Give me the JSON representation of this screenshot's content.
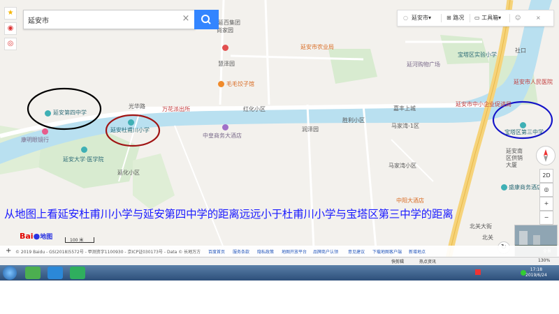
{
  "search": {
    "value": "延安市",
    "clear_icon": "×"
  },
  "toolbar": {
    "city": "延安市",
    "city_chevron": "▾",
    "route": "路况",
    "tools": "工具箱",
    "tools_chevron": "▾",
    "close": "×"
  },
  "map_labels": {
    "baibai": "延百集团",
    "shangjia": "尚家园",
    "farm_bureau": "延安市农业局",
    "huiyuan": "慧泽园",
    "maomao": "毛毛饺子馆",
    "baota_exp": "宝塔区实验小学",
    "shezi": "社口",
    "yanhe_plaza": "延河购物广场",
    "people_hospital": "延安市人民医院",
    "smb": "延安市中小企业促进局",
    "guanghua": "光华路",
    "wanhua": "万花派出所",
    "hongqi": "红化小区",
    "jiachun": "嘉丰上城",
    "shengli": "胜利小区",
    "majiawan1": "马家湾-1区",
    "zhonghuang": "中皇商务大酒店",
    "runze": "润泽园",
    "majiawan": "马家湾小区",
    "school4": "延安第四中学",
    "dufu_school": "延安杜甫川小学",
    "kangming": "康明眼镜行",
    "yanda_med": "延安大学·医学院",
    "yanhua": "延化小区",
    "baota3": "宝塔区第三中学",
    "yanan_south": "延安南区供销大厦",
    "shengda": "盛康商务酒店",
    "zhongyang": "中阳大酒店",
    "beiguan": "北关大街",
    "north_road": "北关"
  },
  "annotation": "从地图上看延安杜甫川小学与延安第四中学的距离远远小于杜甫川小学与宝塔区第三中学的距离",
  "controls": {
    "compass": "N",
    "mode_2d": "2D",
    "locate": "◎",
    "zoom_in": "+",
    "zoom_out": "−"
  },
  "footer": {
    "logo_text": "Bai",
    "logo_map": "地图",
    "scale": "100 米",
    "copyright": "© 2019 Baidu - GS(2018)5572号 - 甲测资字1100930 - 京ICP证030173号 - Data © 长地万方",
    "links": [
      "百度首页",
      "服务条款",
      "隐私政策",
      "地图开放平台",
      "品牌商户认领",
      "意见建议",
      "下载地图客户端",
      "新增地点"
    ],
    "pano_label": "全景"
  },
  "statusbar": {
    "left": "快剪辑",
    "hot": "热点资讯",
    "zoom": "130%"
  },
  "taskbar": {
    "time": "17:18",
    "date": "2019/6/24"
  },
  "colors": {
    "blue_text": "#1a1aff",
    "search_button": "#3385ff",
    "road_yellow": "#f6d37a",
    "water": "#b9e0f0"
  }
}
